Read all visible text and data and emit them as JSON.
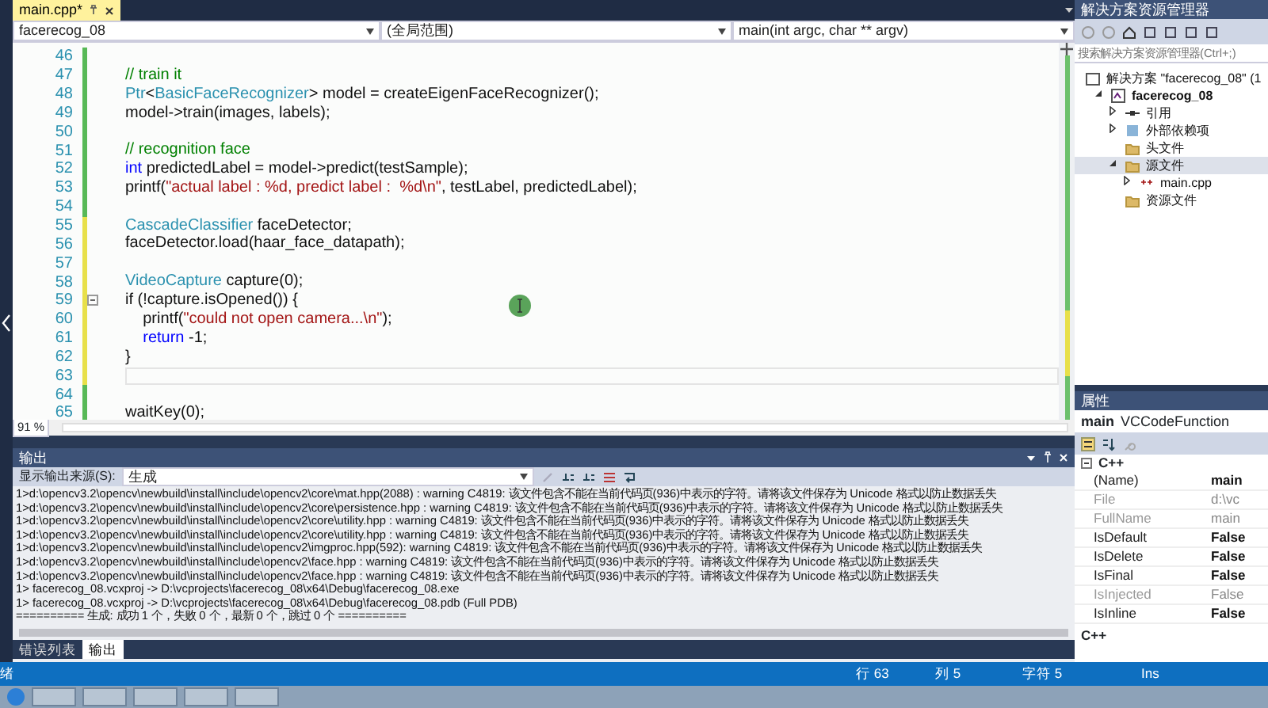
{
  "editor": {
    "tabs": [
      {
        "label": "main.cpp*",
        "selected": true
      }
    ],
    "nav": {
      "project": "facerecog_08",
      "scope": "(全局范围)",
      "member": "main(int argc, char ** argv)"
    },
    "lines": [
      {
        "number": "46",
        "saved": true,
        "current": false,
        "foldable": false
      },
      {
        "number": "47",
        "saved": true,
        "current": false,
        "foldable": false,
        "tokens": [
          {
            "kind": "comment",
            "text": "// train it"
          }
        ]
      },
      {
        "number": "48",
        "saved": true,
        "current": false,
        "foldable": false,
        "tokens": [
          {
            "kind": "type",
            "text": "Ptr"
          },
          {
            "kind": "plain",
            "text": "<"
          },
          {
            "kind": "type",
            "text": "BasicFaceRecognizer"
          },
          {
            "kind": "plain",
            "text": "> model = createEigenFaceRecognizer();"
          }
        ]
      },
      {
        "number": "49",
        "saved": true,
        "current": false,
        "foldable": false,
        "tokens": [
          {
            "kind": "plain",
            "text": "model->train(images, labels);"
          }
        ]
      },
      {
        "number": "50",
        "saved": true,
        "current": false,
        "foldable": false
      },
      {
        "number": "51",
        "saved": true,
        "current": false,
        "foldable": false,
        "tokens": [
          {
            "kind": "comment",
            "text": "// recognition face"
          }
        ]
      },
      {
        "number": "52",
        "saved": true,
        "current": false,
        "foldable": false,
        "tokens": [
          {
            "kind": "keyword",
            "text": "int"
          },
          {
            "kind": "plain",
            "text": " predictedLabel = model->predict(testSample);"
          }
        ]
      },
      {
        "number": "53",
        "saved": true,
        "current": false,
        "foldable": false,
        "tokens": [
          {
            "kind": "plain",
            "text": "printf("
          },
          {
            "kind": "string",
            "text": "\"actual label : %d, predict label :  %d\\n\""
          },
          {
            "kind": "plain",
            "text": ", testLabel, predictedLabel);"
          }
        ]
      },
      {
        "number": "54",
        "saved": true,
        "current": false,
        "foldable": false
      },
      {
        "number": "55",
        "saved": false,
        "current": false,
        "foldable": false,
        "tokens": [
          {
            "kind": "type",
            "text": "CascadeClassifier"
          },
          {
            "kind": "plain",
            "text": " faceDetector;"
          }
        ]
      },
      {
        "number": "56",
        "saved": false,
        "current": false,
        "foldable": false,
        "tokens": [
          {
            "kind": "plain",
            "text": "faceDetector.load(haar_face_datapath);"
          }
        ]
      },
      {
        "number": "57",
        "saved": false,
        "current": false,
        "foldable": false
      },
      {
        "number": "58",
        "saved": false,
        "current": false,
        "foldable": false,
        "tokens": [
          {
            "kind": "type",
            "text": "VideoCapture"
          },
          {
            "kind": "plain",
            "text": " capture(0);"
          }
        ]
      },
      {
        "number": "59",
        "saved": false,
        "current": false,
        "foldable": true,
        "tokens": [
          {
            "kind": "plain",
            "text": "if (!capture.isOpened()) {"
          }
        ]
      },
      {
        "number": "60",
        "saved": false,
        "current": false,
        "foldable": false,
        "tokens": [
          {
            "kind": "plain",
            "text": "    printf("
          },
          {
            "kind": "string",
            "text": "\"could not open camera...\\n\""
          },
          {
            "kind": "plain",
            "text": ");"
          }
        ]
      },
      {
        "number": "61",
        "saved": false,
        "current": false,
        "foldable": false,
        "tokens": [
          {
            "kind": "keyword",
            "text": "    return"
          },
          {
            "kind": "plain",
            "text": " -1;"
          }
        ]
      },
      {
        "number": "62",
        "saved": false,
        "current": false,
        "foldable": false,
        "tokens": [
          {
            "kind": "plain",
            "text": "}"
          }
        ]
      },
      {
        "number": "63",
        "saved": false,
        "current": true,
        "foldable": false
      },
      {
        "number": "64",
        "saved": true,
        "current": false,
        "foldable": false
      },
      {
        "number": "65",
        "saved": true,
        "current": false,
        "foldable": false,
        "tokens": [
          {
            "kind": "plain",
            "text": "waitKey(0);"
          }
        ]
      }
    ],
    "zoom": "91 %"
  },
  "output": {
    "title": "输出",
    "source_label": "显示输出来源(S):",
    "source": "生成",
    "lines": [
      "1>d:\\opencv3.2\\opencv\\newbuild\\install\\include\\opencv2\\core\\mat.hpp(2088) : warning C4819: 该文件包含不能在当前代码页(936)中表示的字符。请将该文件保存为 Unicode 格式以防止数据丢失",
      "1>d:\\opencv3.2\\opencv\\newbuild\\install\\include\\opencv2\\core\\persistence.hpp : warning C4819: 该文件包含不能在当前代码页(936)中表示的字符。请将该文件保存为 Unicode 格式以防止数据丢失",
      "1>d:\\opencv3.2\\opencv\\newbuild\\install\\include\\opencv2\\core\\utility.hpp : warning C4819: 该文件包含不能在当前代码页(936)中表示的字符。请将该文件保存为 Unicode 格式以防止数据丢失",
      "1>d:\\opencv3.2\\opencv\\newbuild\\install\\include\\opencv2\\core\\utility.hpp : warning C4819: 该文件包含不能在当前代码页(936)中表示的字符。请将该文件保存为 Unicode 格式以防止数据丢失",
      "1>d:\\opencv3.2\\opencv\\newbuild\\install\\include\\opencv2\\imgproc.hpp(592): warning C4819: 该文件包含不能在当前代码页(936)中表示的字符。请将该文件保存为 Unicode 格式以防止数据丢失",
      "1>d:\\opencv3.2\\opencv\\newbuild\\install\\include\\opencv2\\face.hpp : warning C4819: 该文件包含不能在当前代码页(936)中表示的字符。请将该文件保存为 Unicode 格式以防止数据丢失",
      "1>d:\\opencv3.2\\opencv\\newbuild\\install\\include\\opencv2\\face.hpp : warning C4819: 该文件包含不能在当前代码页(936)中表示的字符。请将该文件保存为 Unicode 格式以防止数据丢失",
      "1>  facerecog_08.vcxproj -> D:\\vcprojects\\facerecog_08\\x64\\Debug\\facerecog_08.exe",
      "1>  facerecog_08.vcxproj -> D:\\vcprojects\\facerecog_08\\x64\\Debug\\facerecog_08.pdb (Full PDB)",
      "========== 生成: 成功 1 个，失败 0 个，最新 0 个，跳过 0 个 =========="
    ],
    "tabs": [
      {
        "label": "错误列表",
        "selected": false
      },
      {
        "label": "输出",
        "selected": true
      }
    ]
  },
  "solution_explorer": {
    "title": "解决方案资源管理器",
    "search": {
      "placeholder": "搜索解决方案资源管理器(Ctrl+;)"
    },
    "tree": [
      {
        "kind": "solution",
        "label": "解决方案 \"facerecog_08\" (1",
        "selected": false,
        "children": [
          {
            "kind": "project",
            "label": "facerecog_08",
            "selected": false,
            "expanded": true,
            "children": [
              {
                "kind": "references",
                "label": "引用",
                "selected": false,
                "expanded": false
              },
              {
                "kind": "dependencies",
                "label": "外部依赖项",
                "selected": false,
                "expanded": false
              },
              {
                "kind": "folder",
                "label": "头文件",
                "selected": false
              },
              {
                "kind": "folder",
                "label": "源文件",
                "selected": true,
                "expanded": true,
                "children": [
                  {
                    "kind": "file",
                    "label": "main.cpp",
                    "selected": false,
                    "expanded": false
                  }
                ]
              },
              {
                "kind": "folder",
                "label": "资源文件",
                "selected": false
              }
            ]
          }
        ]
      }
    ]
  },
  "properties": {
    "title": "属性",
    "object_name": "main",
    "object_type": "VCCodeFunction",
    "category": "C++",
    "rows": [
      {
        "name": "(Name)",
        "value": "main",
        "disabled": false
      },
      {
        "name": "File",
        "value": "d:\\vc",
        "disabled": true
      },
      {
        "name": "FullName",
        "value": "main",
        "disabled": true
      },
      {
        "name": "IsDefault",
        "value": "False",
        "disabled": false
      },
      {
        "name": "IsDelete",
        "value": "False",
        "disabled": false
      },
      {
        "name": "IsFinal",
        "value": "False",
        "disabled": false
      },
      {
        "name": "IsInjected",
        "value": "False",
        "disabled": true
      },
      {
        "name": "IsInline",
        "value": "False",
        "disabled": false
      }
    ],
    "description": "C++"
  },
  "status_bar": {
    "message": "绪",
    "items": [
      "行 63",
      "列 5",
      "字符 5",
      "Ins"
    ]
  }
}
